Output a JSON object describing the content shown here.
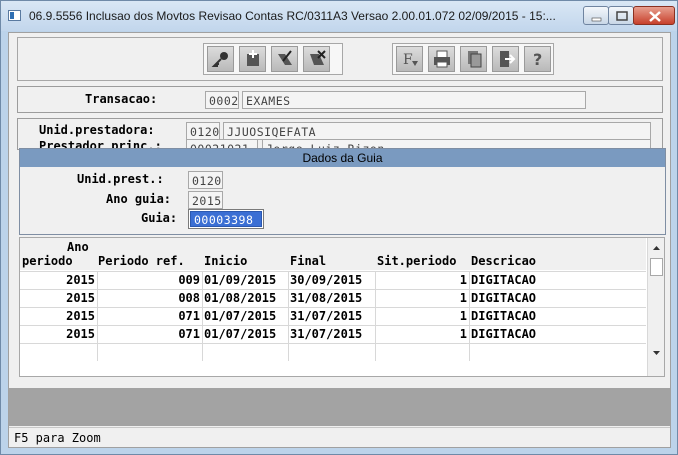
{
  "window": {
    "title": "06.9.5556 Inclusao dos Movtos Revisao Contas RC/0311A3 Versao 2.00.01.072 02/09/2015 - 15:..."
  },
  "toolbar": {
    "group1": [
      "key-icon",
      "add-icon",
      "edit-icon",
      "delete-icon"
    ],
    "group2": [
      "filter-icon",
      "print-icon",
      "copy-icon",
      "exit-icon",
      "help-icon"
    ]
  },
  "header": {
    "transacao_label": "Transacao:",
    "transacao_code": "0002",
    "transacao_desc": "EXAMES"
  },
  "unid": {
    "unid_label": "Unid.prestadora:",
    "unid_code": "0120",
    "unid_name": "JJUOSIQEFATA",
    "prestador_label": "Prestador princ.:",
    "prestador_code": "00021021",
    "prestador_name": "Jorge Luiz Rizon"
  },
  "dialog": {
    "title": "Dados da Guia",
    "unid_prest_label": "Unid.prest.:",
    "unid_prest_value": "0120",
    "ano_guia_label": "Ano guia:",
    "ano_guia_value": "2015",
    "guia_label": "Guia:",
    "guia_value": "00003398"
  },
  "grid": {
    "columns": [
      "Ano",
      "periodo",
      "Periodo ref.",
      "Inicio",
      "Final",
      "Sit.periodo",
      "Descricao"
    ],
    "rows": [
      {
        "ano": "2015",
        "periodo": "009",
        "inicio": "01/09/2015",
        "final": "30/09/2015",
        "sit": "1",
        "descricao": "DIGITACAO"
      },
      {
        "ano": "2015",
        "periodo": "008",
        "inicio": "01/08/2015",
        "final": "31/08/2015",
        "sit": "1",
        "descricao": "DIGITACAO"
      },
      {
        "ano": "2015",
        "periodo": "071",
        "inicio": "01/07/2015",
        "final": "31/07/2015",
        "sit": "1",
        "descricao": "DIGITACAO"
      },
      {
        "ano": "2015",
        "periodo": "071",
        "inicio": "01/07/2015",
        "final": "31/07/2015",
        "sit": "1",
        "descricao": "DIGITACAO"
      }
    ]
  },
  "status": {
    "text": "F5 para Zoom"
  },
  "colors": {
    "selection": "#3b6fd4",
    "dialog_title": "#7a9ac0",
    "gray_band": "#a3a3a3"
  }
}
